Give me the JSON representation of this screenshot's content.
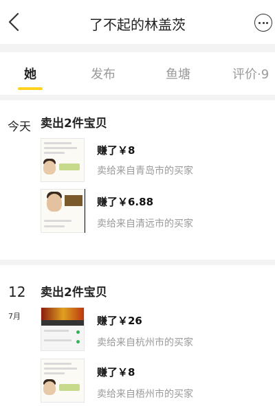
{
  "nav": {
    "title": "了不起的林盖茨",
    "back_icon": "chevron-left-icon",
    "more_icon": "more-horizontal-circle-icon"
  },
  "tabs": [
    {
      "label": "她",
      "active": true
    },
    {
      "label": "发布",
      "active": false
    },
    {
      "label": "鱼塘",
      "active": false
    },
    {
      "label": "评价·9",
      "active": false
    }
  ],
  "accent_color": "#ffd21f",
  "groups": [
    {
      "day": "今天",
      "title": "卖出2件宝贝",
      "items": [
        {
          "earned": "赚了￥8",
          "buyer": "卖给来自青岛市的买家"
        },
        {
          "earned": "赚了￥6.88",
          "buyer": "卖给来自清远市的买家"
        }
      ]
    },
    {
      "day": "12",
      "month": "7月",
      "title": "卖出2件宝贝",
      "items": [
        {
          "earned": "赚了￥26",
          "buyer": "卖给来自杭州市的买家"
        },
        {
          "earned": "赚了￥8",
          "buyer": "卖给来自梧州市的买家"
        }
      ]
    }
  ]
}
